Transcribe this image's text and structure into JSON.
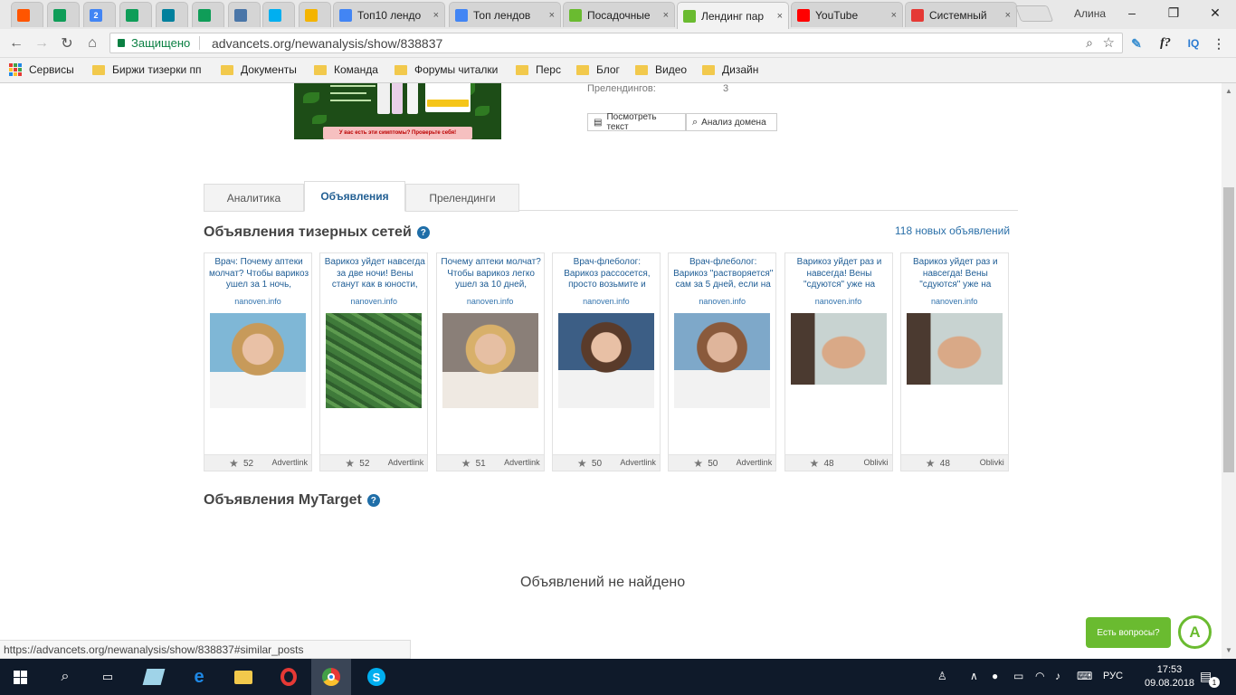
{
  "browser": {
    "tabs": [
      {
        "title": "",
        "icon": "soundcloud-icon",
        "color": "#ff5500"
      },
      {
        "title": "",
        "icon": "sheets-icon",
        "color": "#0f9d58"
      },
      {
        "title": "",
        "icon": "calendar-icon",
        "color": "#4285f4",
        "badge": "2"
      },
      {
        "title": "",
        "icon": "sheets-icon",
        "color": "#0f9d58"
      },
      {
        "title": "",
        "icon": "bing-icon",
        "color": "#00809d"
      },
      {
        "title": "",
        "icon": "sheets-icon",
        "color": "#0f9d58"
      },
      {
        "title": "",
        "icon": "vk-icon",
        "color": "#4a76a8"
      },
      {
        "title": "",
        "icon": "skype-icon",
        "color": "#00aff0"
      },
      {
        "title": "",
        "icon": "drive-icon",
        "color": "#f4b400"
      },
      {
        "title": "Топ10 лендо",
        "icon": "docs-icon",
        "color": "#4285f4"
      },
      {
        "title": "Топ лендов",
        "icon": "docs-icon",
        "color": "#4285f4"
      },
      {
        "title": "Посадочные",
        "icon": "advancets-icon",
        "color": "#6abb30"
      },
      {
        "title": "Лендинг пар",
        "icon": "advancets-icon",
        "color": "#6abb30"
      },
      {
        "title": "YouTube",
        "icon": "youtube-icon",
        "color": "#ff0000"
      },
      {
        "title": "Системный",
        "icon": "system-icon",
        "color": "#e53935"
      }
    ],
    "close_glyph": "×",
    "user_name": "Алина",
    "minimize": "–",
    "maximize": "❐",
    "close": "✕",
    "secure_label": "Защищено",
    "url": "advancets.org/newanalysis/show/838837",
    "bookmarks": [
      "Сервисы",
      "Биржи тизерки пп",
      "Документы",
      "Команда",
      "Форумы читалки",
      "Перс",
      "Блог",
      "Видео",
      "Дизайн"
    ]
  },
  "landing": {
    "prelandings_label": "Прелендингов:",
    "prelandings_value": "3",
    "view_text_button": "Посмотреть текст",
    "domain_analysis_button": "Анализ домена",
    "banner_text": "У вас есть эти симптомы? Проверьте себя!"
  },
  "content_tabs": [
    "Аналитика",
    "Объявления",
    "Прелендинги"
  ],
  "teasers": {
    "heading": "Объявления тизерных сетей",
    "new_count": "118 новых объявлений",
    "ads": [
      {
        "title": "Врач: Почему аптеки молчат? Чтобы варикоз ушел за 1 ночь,",
        "domain": "nanoven.info",
        "count": "52",
        "network": "Advertlink"
      },
      {
        "title": "Варикоз уйдет навсегда за две ночи! Вены станут как в юности,",
        "domain": "nanoven.info",
        "count": "52",
        "network": "Advertlink"
      },
      {
        "title": "Почему аптеки молчат? Чтобы варикоз легко ушел за 10 дней,",
        "domain": "nanoven.info",
        "count": "51",
        "network": "Advertlink"
      },
      {
        "title": "Врач-флеболог: Варикоз рассосется, просто возьмите и",
        "domain": "nanoven.info",
        "count": "50",
        "network": "Advertlink"
      },
      {
        "title": "Врач-флеболог: Варикоз \"растворяется\" сам за 5 дней, если на",
        "domain": "nanoven.info",
        "count": "50",
        "network": "Advertlink"
      },
      {
        "title": "Варикоз уйдет раз и навсегда! Вены \"сдуются\" уже на",
        "domain": "nanoven.info",
        "count": "48",
        "network": "Oblivki"
      },
      {
        "title": "Варикоз уйдет раз и навсегда! Вены \"сдуются\" уже на",
        "domain": "nanoven.info",
        "count": "48",
        "network": "Oblivki"
      }
    ]
  },
  "mytarget": {
    "heading": "Объявления MyTarget",
    "empty": "Объявлений не найдено"
  },
  "status_url": "https://advancets.org/newanalysis/show/838837#similar_posts",
  "chat": {
    "label": "Есть вопросы?"
  },
  "taskbar": {
    "lang": "РУС",
    "time": "17:53",
    "date": "09.08.2018",
    "notif": "1"
  },
  "colors": {
    "accent": "#6abb30",
    "link": "#1f5d95",
    "tab_active": "#225f93"
  }
}
